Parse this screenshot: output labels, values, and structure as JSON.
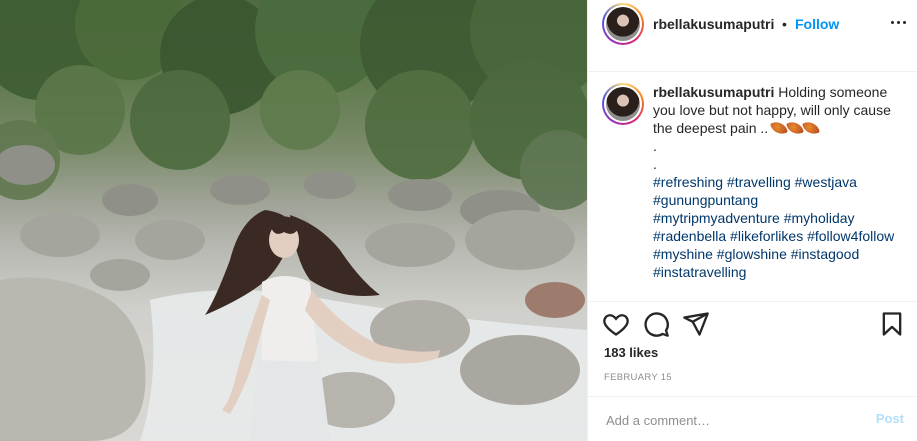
{
  "post": {
    "username": "rbellakusumaputri",
    "separator": "•",
    "follow_label": "Follow",
    "caption": {
      "username": "rbellakusumaputri",
      "text": "Holding someone you love but not happy, will only cause the deepest pain ..",
      "dot_lines": [
        ".",
        "."
      ],
      "hashtags_lines": [
        "#refreshing #travelling #westjava",
        "#gunungpuntang",
        "#mytripmyadventure #myholiday",
        "#radenbella #likeforlikes #follow4follow",
        "#myshine #glowshine #instagood",
        "#instatravelling"
      ]
    },
    "likes": "183 likes",
    "date": "FEBRUARY 15",
    "comment": {
      "placeholder": "Add a comment…",
      "value": "",
      "post_label": "Post"
    },
    "colors": {
      "follow": "#0095f6",
      "hashtag": "#00376b",
      "post_disabled": "#b2dffc",
      "muted": "#8e8e8e"
    },
    "icons": [
      "more-options-icon",
      "heart-icon",
      "comment-icon",
      "share-icon",
      "bookmark-icon",
      "leaf-emoji-icon"
    ]
  }
}
